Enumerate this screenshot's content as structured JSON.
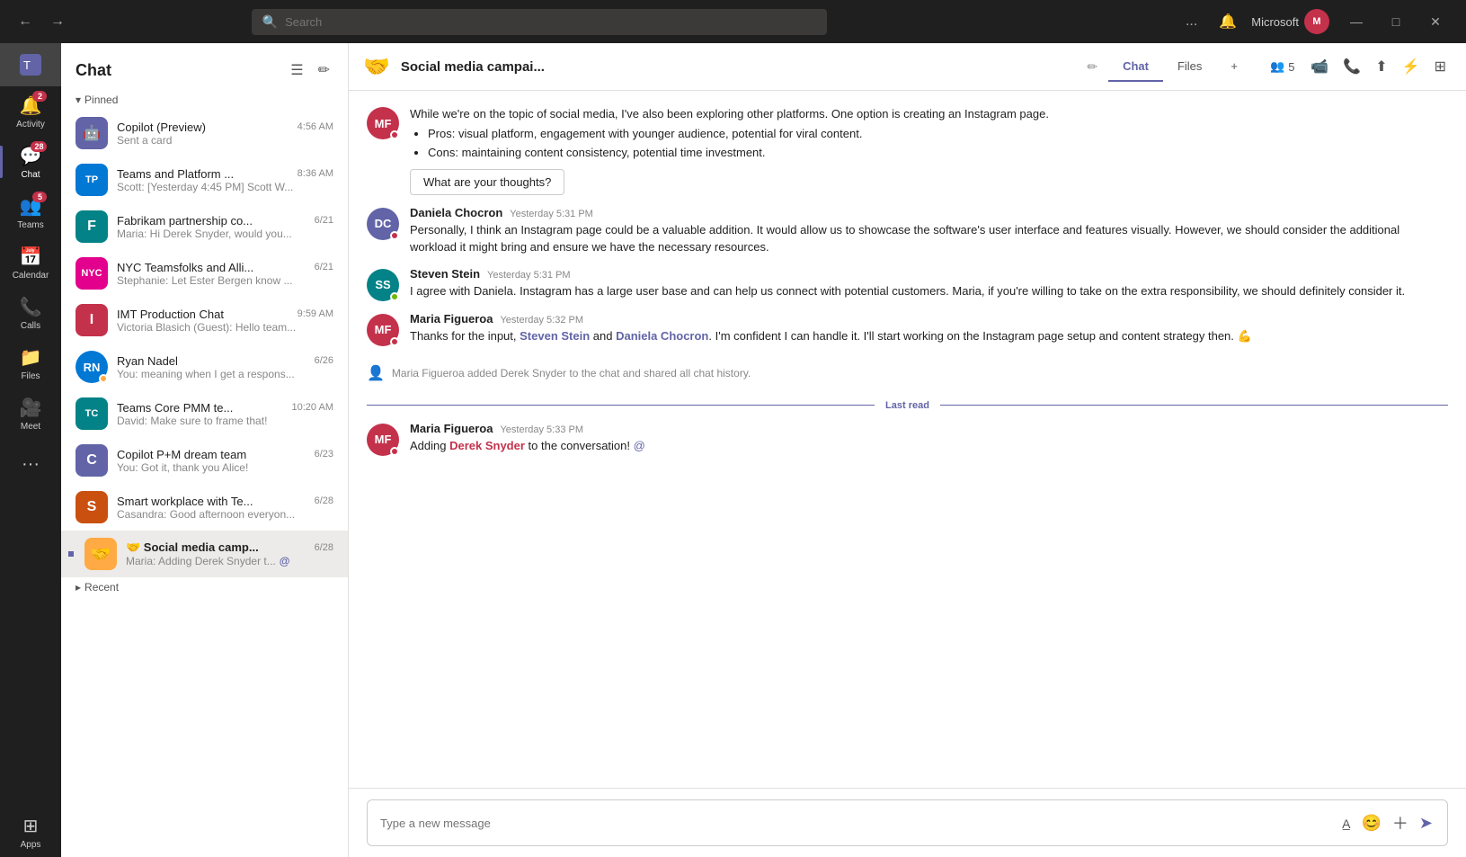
{
  "window": {
    "search_placeholder": "Search",
    "user_name": "Microsoft",
    "nav_back": "←",
    "nav_forward": "→",
    "btn_minimize": "—",
    "btn_maximize": "□",
    "btn_close": "✕",
    "btn_ellipsis": "..."
  },
  "nav": {
    "items": [
      {
        "id": "activity",
        "label": "Activity",
        "icon": "🔔",
        "badge": "2"
      },
      {
        "id": "chat",
        "label": "Chat",
        "icon": "💬",
        "badge": "28",
        "active": true
      },
      {
        "id": "teams",
        "label": "Teams",
        "icon": "👥",
        "badge": "5"
      },
      {
        "id": "calendar",
        "label": "Calendar",
        "icon": "📅"
      },
      {
        "id": "calls",
        "label": "Calls",
        "icon": "📞"
      },
      {
        "id": "files",
        "label": "Files",
        "icon": "📁"
      },
      {
        "id": "meet",
        "label": "Meet",
        "icon": "🎥"
      },
      {
        "id": "more",
        "label": "...",
        "icon": "···"
      },
      {
        "id": "apps",
        "label": "Apps",
        "icon": "⊞"
      }
    ]
  },
  "chat_panel": {
    "title": "Chat",
    "filter_icon": "≡",
    "compose_icon": "✏",
    "pinned_label": "Pinned",
    "recent_label": "Recent",
    "items": [
      {
        "id": "copilot",
        "name": "Copilot (Preview)",
        "preview": "Sent a card",
        "time": "4:56 AM",
        "avatar_text": "🤖",
        "avatar_color": "#6264a7",
        "status": "none",
        "pinned": true
      },
      {
        "id": "teams-platform",
        "name": "Teams and Platform ...",
        "preview": "Scott: [Yesterday 4:45 PM] Scott W...",
        "time": "8:36 AM",
        "avatar_text": "TP",
        "avatar_color": "#0078d4",
        "status": "none",
        "pinned": true
      },
      {
        "id": "fabrikam",
        "name": "Fabrikam partnership co...",
        "preview": "Maria: Hi Derek Snyder, would you...",
        "time": "6/21",
        "avatar_text": "F",
        "avatar_color": "#038387",
        "status": "none",
        "pinned": true
      },
      {
        "id": "nyc-teamsfolks",
        "name": "NYC Teamsfolks and Alli...",
        "preview": "Stephanie: Let Ester Bergen know ...",
        "time": "6/21",
        "avatar_text": "N",
        "avatar_color": "#e3008c",
        "status": "none",
        "pinned": true
      },
      {
        "id": "imt-production",
        "name": "IMT Production Chat",
        "preview": "Victoria Blasich (Guest): Hello team...",
        "time": "9:59 AM",
        "avatar_text": "I",
        "avatar_color": "#c4314b",
        "status": "none",
        "pinned": true
      },
      {
        "id": "ryan-nadel",
        "name": "Ryan Nadel",
        "preview": "You: meaning when I get a respons...",
        "time": "6/26",
        "avatar_text": "RN",
        "avatar_color": "#0078d4",
        "status": "away",
        "pinned": true
      },
      {
        "id": "teams-core",
        "name": "Teams Core PMM te...",
        "preview": "David: Make sure to frame that!",
        "time": "10:20 AM",
        "avatar_text": "TC",
        "avatar_color": "#038387",
        "status": "none",
        "pinned": true
      },
      {
        "id": "copilot-pm",
        "name": "Copilot P+M dream team",
        "preview": "You: Got it, thank you Alice!",
        "time": "6/23",
        "avatar_text": "C",
        "avatar_color": "#6264a7",
        "status": "none",
        "pinned": true
      },
      {
        "id": "smart-workplace",
        "name": "Smart workplace with Te...",
        "preview": "Casandra: Good afternoon everyon...",
        "time": "6/28",
        "avatar_text": "S",
        "avatar_color": "#ca5010",
        "status": "none",
        "pinned": true
      },
      {
        "id": "social-media",
        "name": "🤝 Social media camp...",
        "preview": "Maria: Adding Derek Snyder t...",
        "time": "6/28",
        "avatar_text": "🤝",
        "avatar_color": "#ffaa44",
        "status": "none",
        "pinned": true,
        "active": true,
        "unread": true,
        "mention": true
      }
    ]
  },
  "chat_header": {
    "group_emoji": "🤝",
    "group_name": "Social media campai...",
    "edit_icon": "✏",
    "tabs": [
      {
        "id": "chat",
        "label": "Chat",
        "active": true
      },
      {
        "id": "files",
        "label": "Files"
      }
    ],
    "add_tab": "+",
    "participants_count": "5",
    "participants_icon": "👥",
    "video_icon": "📹",
    "phone_icon": "📞",
    "share_icon": "⬆",
    "apps_icon": "⚡",
    "more_icon": "⊞"
  },
  "messages": [
    {
      "id": "msg1",
      "author": "Maria Figueroa",
      "author_initials": "MF",
      "author_color": "#c4314b",
      "status": "busy",
      "timestamp": "",
      "text": "While we're on the topic of social media, I've also been exploring other platforms. One option is creating an Instagram page.",
      "bullets": [
        "Pros: visual platform, engagement with younger audience, potential for viral content.",
        "Cons: maintaining content consistency, potential time investment."
      ],
      "action_button": "What are your thoughts?"
    },
    {
      "id": "msg2",
      "author": "Daniela Chocron",
      "author_initials": "DC",
      "author_color": "#6264a7",
      "status": "busy",
      "timestamp": "Yesterday 5:31 PM",
      "text": "Personally, I think an Instagram page could be a valuable addition. It would allow us to showcase the software's user interface and features visually. However, we should consider the additional workload it might bring and ensure we have the necessary resources."
    },
    {
      "id": "msg3",
      "author": "Steven Stein",
      "author_initials": "SS",
      "author_color": "#038387",
      "status": "online",
      "timestamp": "Yesterday 5:31 PM",
      "text": "I agree with Daniela. Instagram has a large user base and can help us connect with potential customers. Maria, if you're willing to take on the extra responsibility, we should definitely consider it."
    },
    {
      "id": "msg4",
      "author": "Maria Figueroa",
      "author_initials": "MF",
      "author_color": "#c4314b",
      "status": "busy",
      "timestamp": "Yesterday 5:32 PM",
      "text_parts": [
        {
          "text": "Thanks for the input, ",
          "type": "normal"
        },
        {
          "text": "Steven Stein",
          "type": "mention"
        },
        {
          "text": " and ",
          "type": "normal"
        },
        {
          "text": "Daniela Chocron",
          "type": "mention"
        },
        {
          "text": ". I'm confident I can handle it. I'll start working on the Instagram page setup and content strategy then. 💪",
          "type": "normal"
        }
      ]
    },
    {
      "id": "system1",
      "type": "system",
      "text": "Maria Figueroa added Derek Snyder to the chat and shared all chat history."
    },
    {
      "id": "msg5",
      "author": "Maria Figueroa",
      "author_initials": "MF",
      "author_color": "#c4314b",
      "status": "busy",
      "timestamp": "Yesterday 5:33 PM",
      "text_parts": [
        {
          "text": "Adding ",
          "type": "normal"
        },
        {
          "text": "Derek Snyder",
          "type": "mention_bold"
        },
        {
          "text": " to the conversation!",
          "type": "normal"
        }
      ],
      "at_icon": true
    }
  ],
  "last_read": "Last read",
  "compose": {
    "placeholder": "Type a new message",
    "format_icon": "A",
    "emoji_icon": "😊",
    "attach_icon": "+",
    "send_icon": "➤"
  }
}
